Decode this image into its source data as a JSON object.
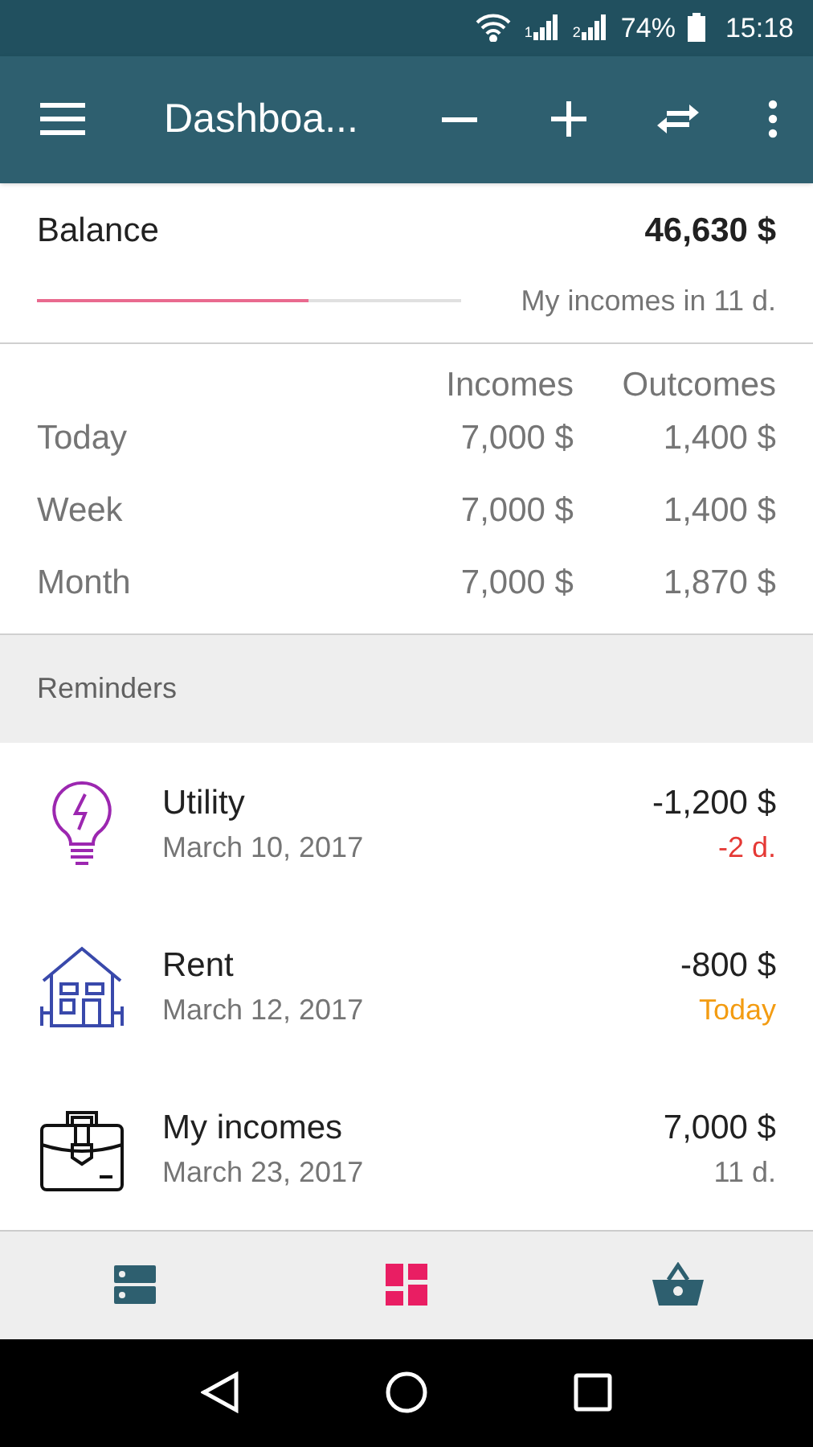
{
  "status_bar": {
    "battery": "74%",
    "time": "15:18",
    "sim_labels": [
      "1",
      "2"
    ]
  },
  "toolbar": {
    "title": "Dashboa..."
  },
  "balance": {
    "label": "Balance",
    "amount": "46,630 $",
    "level": 0.64,
    "note": "My incomes in 11 d."
  },
  "summary": {
    "columns": [
      "Incomes",
      "Outcomes"
    ],
    "rows": [
      {
        "label": "Today",
        "incomes": "7,000 $",
        "outcomes": "1,400 $"
      },
      {
        "label": "Week",
        "incomes": "7,000 $",
        "outcomes": "1,400 $"
      },
      {
        "label": "Month",
        "incomes": "7,000 $",
        "outcomes": "1,870 $"
      }
    ]
  },
  "reminders": {
    "header": "Reminders",
    "items": [
      {
        "name": "Utility",
        "date": "March 10, 2017",
        "amount": "-1,200 $",
        "due": "-2 d.",
        "kind": "overdue"
      },
      {
        "name": "Rent",
        "date": "March 12, 2017",
        "amount": "-800 $",
        "due": "Today",
        "kind": "today"
      },
      {
        "name": "My incomes",
        "date": "March 23, 2017",
        "amount": "7,000 $",
        "due": "11 d.",
        "kind": "upcoming"
      }
    ]
  },
  "bottom_nav": [
    {
      "selected": false
    },
    {
      "selected": true
    },
    {
      "selected": false
    }
  ]
}
